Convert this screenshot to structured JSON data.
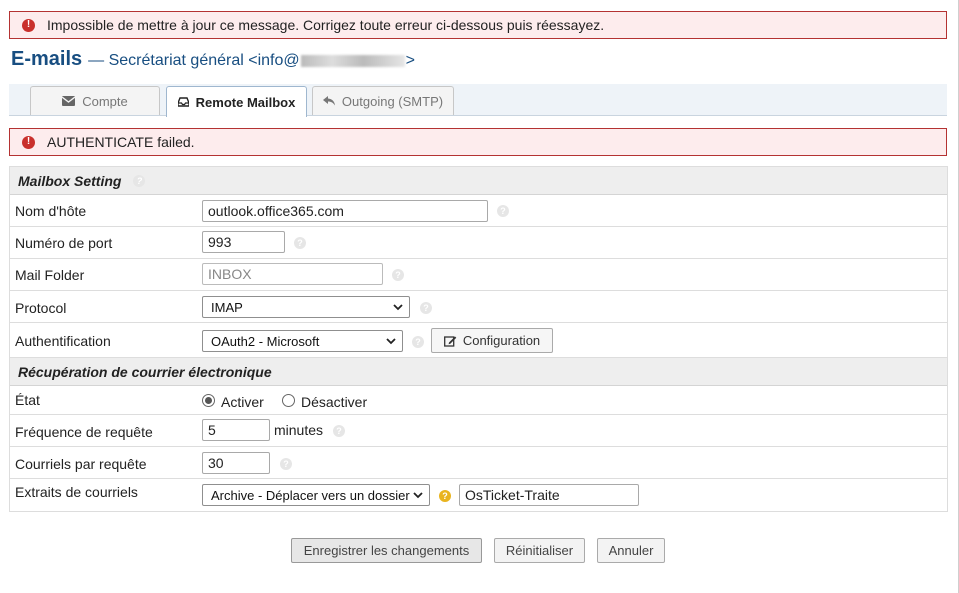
{
  "alerts": {
    "top_error": "Impossible de mettre à jour ce message. Corrigez toute erreur ci-dessous puis réessayez.",
    "auth_error": "AUTHENTICATE failed."
  },
  "header": {
    "title": "E-mails",
    "subtitle_prefix": "— Secrétariat général <info@",
    "subtitle_suffix": ">"
  },
  "tabs": [
    {
      "label": "Compte",
      "icon": "envelope-icon",
      "active": false
    },
    {
      "label": "Remote Mailbox",
      "icon": "inbox-icon",
      "active": true
    },
    {
      "label": "Outgoing (SMTP)",
      "icon": "reply-icon",
      "active": false
    }
  ],
  "sections": {
    "mailbox": "Mailbox Setting",
    "fetch": "Récupération de courrier électronique"
  },
  "fields": {
    "hostname": {
      "label": "Nom d'hôte",
      "value": "outlook.office365.com"
    },
    "port": {
      "label": "Numéro de port",
      "value": "993"
    },
    "folder": {
      "label": "Mail Folder",
      "placeholder": "INBOX"
    },
    "protocol": {
      "label": "Protocol",
      "value": "IMAP"
    },
    "auth": {
      "label": "Authentification",
      "value": "OAuth2 - Microsoft",
      "config_button": "Configuration"
    },
    "state": {
      "label": "État",
      "option_on": "Activer",
      "option_off": "Désactiver",
      "selected": "Activer"
    },
    "frequency": {
      "label": "Fréquence de requête",
      "value": "5",
      "unit": "minutes"
    },
    "per_fetch": {
      "label": "Courriels par requête",
      "value": "30"
    },
    "fetched": {
      "label": "Extraits de courriels",
      "value": "Archive - Déplacer vers un dossier",
      "folder_value": "OsTicket-Traite"
    }
  },
  "buttons": {
    "save": "Enregistrer les changements",
    "reset": "Réinitialiser",
    "cancel": "Annuler"
  },
  "colors": {
    "error_border": "#b43232",
    "error_bg": "#fdeced",
    "title": "#184e81",
    "help_gold": "#e9b41f"
  }
}
